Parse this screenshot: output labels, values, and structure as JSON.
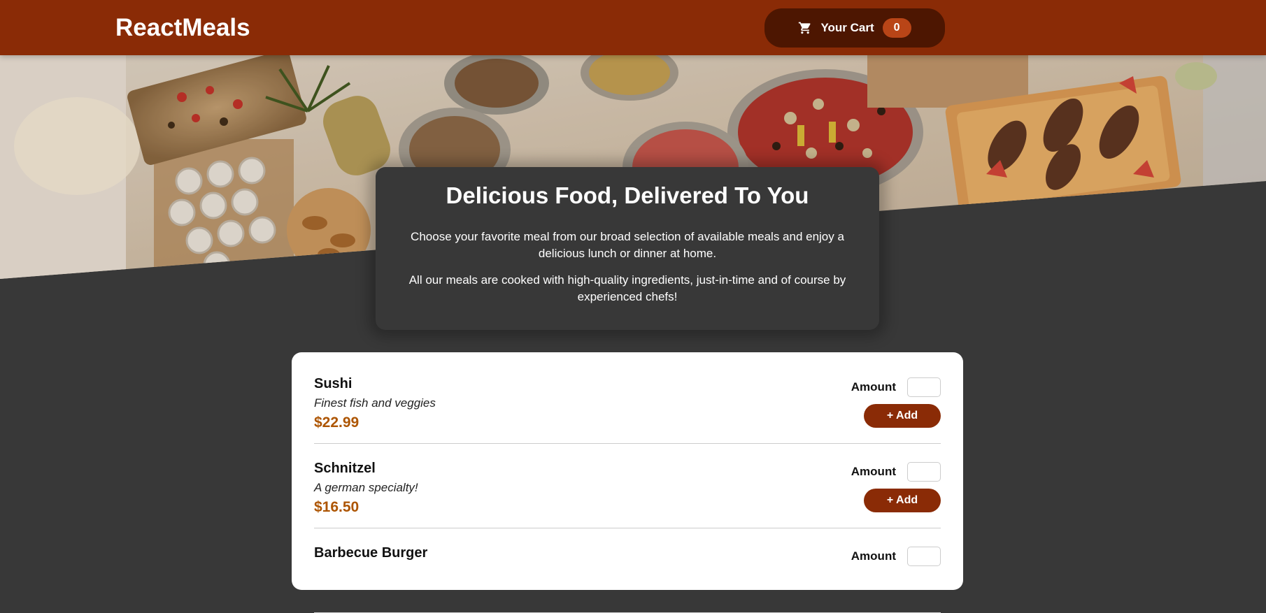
{
  "header": {
    "brand": "ReactMeals",
    "cart": {
      "label": "Your Cart",
      "count": "0",
      "icon": "cart-icon"
    }
  },
  "hero": {
    "image": "buffet-table-food-photo"
  },
  "summary": {
    "title": "Delicious Food, Delivered To You",
    "paragraph1": "Choose your favorite meal from our broad selection of available meals and enjoy a delicious lunch or dinner at home.",
    "paragraph2": "All our meals are cooked with high-quality ingredients, just-in-time and of course by experienced chefs!"
  },
  "meals": [
    {
      "name": "Sushi",
      "description": "Finest fish and veggies",
      "price": "$22.99",
      "amount_label": "Amount",
      "amount_value": "",
      "add_label": "+ Add"
    },
    {
      "name": "Schnitzel",
      "description": "A german specialty!",
      "price": "$16.50",
      "amount_label": "Amount",
      "amount_value": "",
      "add_label": "+ Add"
    },
    {
      "name": "Barbecue Burger",
      "description": "",
      "price": "",
      "amount_label": "Amount",
      "amount_value": "",
      "add_label": ""
    }
  ],
  "colors": {
    "header_bg": "#8a2b06",
    "cart_bg": "#4d1601",
    "badge_bg": "#b94517",
    "page_bg": "#383838",
    "price": "#ad5502",
    "add_button": "#8a2b06"
  }
}
